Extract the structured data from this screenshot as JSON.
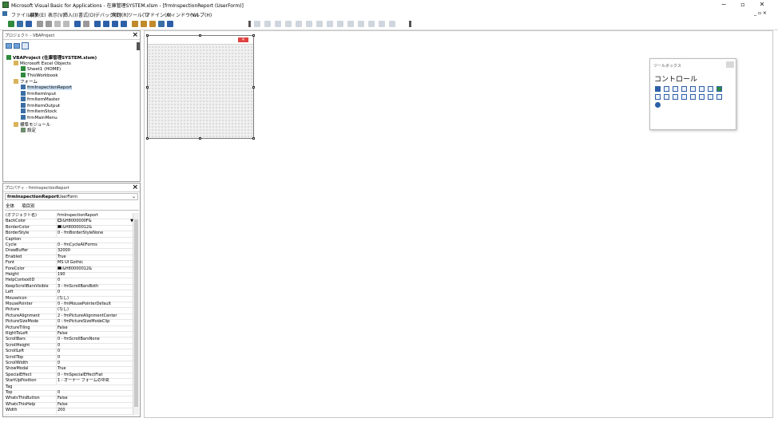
{
  "window": {
    "title": "Microsoft Visual Basic for Applications - 在庫管理SYSTEM.xlsm - [frmInspectionReport (UserForm)]",
    "minimize": "−",
    "restore": "▫",
    "close": "✕",
    "inner_restore": "_ ▫ ×"
  },
  "menu": [
    "ファイル(F)",
    "編集(E)",
    "表示(V)",
    "挿入(I)",
    "書式(O)",
    "デバッグ(D)",
    "実行(R)",
    "ツール(T)",
    "アドイン(A)",
    "ウィンドウ(W)",
    "ヘルプ(H)"
  ],
  "project": {
    "title": "プロジェクト - VBAProject",
    "items": [
      {
        "label": "VBAProject (在庫管理SYSTEM.xlsm)",
        "indent": 0,
        "bold": true
      },
      {
        "label": "Microsoft Excel Objects",
        "indent": 1
      },
      {
        "label": "Sheet1 (HOME)",
        "indent": 2
      },
      {
        "label": "ThisWorkbook",
        "indent": 2
      },
      {
        "label": "フォーム",
        "indent": 1
      },
      {
        "label": "frmInspectionReport",
        "indent": 2
      },
      {
        "label": "frmItemInput",
        "indent": 2
      },
      {
        "label": "frmItemMaster",
        "indent": 2
      },
      {
        "label": "frmItemOutput",
        "indent": 2
      },
      {
        "label": "frmItemStock",
        "indent": 2
      },
      {
        "label": "frmMainMenu",
        "indent": 2
      },
      {
        "label": "標準モジュール",
        "indent": 1
      },
      {
        "label": "設定",
        "indent": 2
      }
    ]
  },
  "properties": {
    "title": "プロパティ - frmInspectionReport",
    "object_name": "frmInspectionReport",
    "object_type": "UserForm",
    "tabs": [
      "全体",
      "項目別"
    ],
    "rows": [
      [
        "(オブジェクト名)",
        "frmInspectionReport"
      ],
      [
        "BackColor",
        "&H8000000F&"
      ],
      [
        "BorderColor",
        "&H80000012&"
      ],
      [
        "BorderStyle",
        "0 - fmBorderStyleNone"
      ],
      [
        "Caption",
        ""
      ],
      [
        "Cycle",
        "0 - fmCycleAllForms"
      ],
      [
        "DrawBuffer",
        "32000"
      ],
      [
        "Enabled",
        "True"
      ],
      [
        "Font",
        "MS UI Gothic"
      ],
      [
        "ForeColor",
        "&H80000012&"
      ],
      [
        "Height",
        "190"
      ],
      [
        "HelpContextID",
        "0"
      ],
      [
        "KeepScrollBarsVisible",
        "3 - fmScrollBarsBoth"
      ],
      [
        "Left",
        "0"
      ],
      [
        "MouseIcon",
        "(なし)"
      ],
      [
        "MousePointer",
        "0 - fmMousePointerDefault"
      ],
      [
        "Picture",
        "(なし)"
      ],
      [
        "PictureAlignment",
        "2 - fmPictureAlignmentCenter"
      ],
      [
        "PictureSizeMode",
        "0 - fmPictureSizeModeClip"
      ],
      [
        "PictureTiling",
        "False"
      ],
      [
        "RightToLeft",
        "False"
      ],
      [
        "ScrollBars",
        "0 - fmScrollBarsNone"
      ],
      [
        "ScrollHeight",
        "0"
      ],
      [
        "ScrollLeft",
        "0"
      ],
      [
        "ScrollTop",
        "0"
      ],
      [
        "ScrollWidth",
        "0"
      ],
      [
        "ShowModal",
        "True"
      ],
      [
        "SpecialEffect",
        "0 - fmSpecialEffectFlat"
      ],
      [
        "StartUpPosition",
        "1 - オーナー フォームの中央"
      ],
      [
        "Tag",
        ""
      ],
      [
        "Top",
        "0"
      ],
      [
        "WhatsThisButton",
        "False"
      ],
      [
        "WhatsThisHelp",
        "False"
      ],
      [
        "Width",
        "200"
      ]
    ]
  },
  "toolbox": {
    "title": "ツールボックス",
    "tab": "コントロール"
  },
  "colors": {
    "accent": "#2d5fa8",
    "form_close": "#e04040"
  }
}
